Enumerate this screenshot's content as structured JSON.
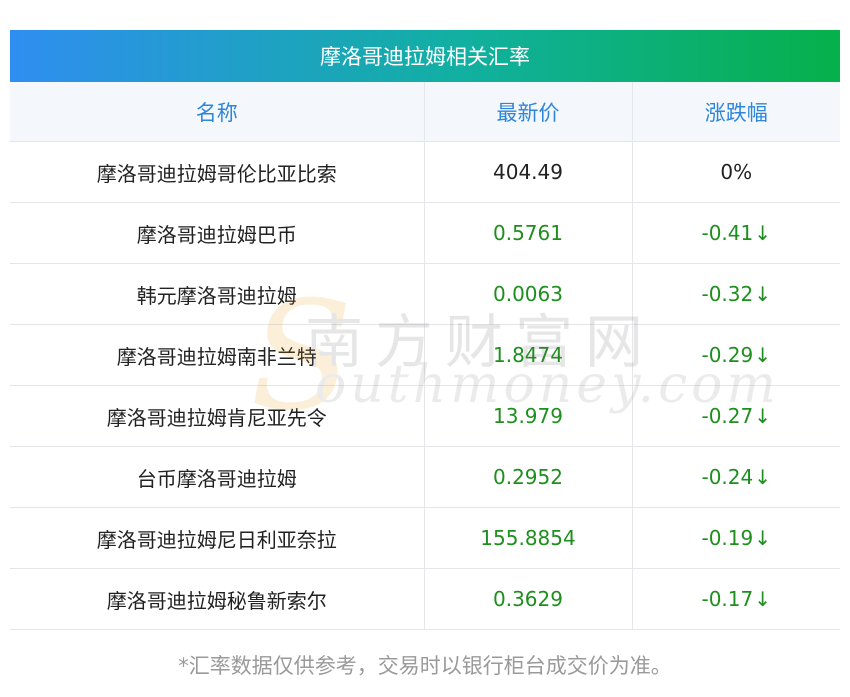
{
  "title": "摩洛哥迪拉姆相关汇率",
  "columns": [
    "名称",
    "最新价",
    "涨跌幅"
  ],
  "colors": {
    "down": "#1e8f1e",
    "neutral": "#222222",
    "header_text": "#2f86d8"
  },
  "rows": [
    {
      "name": "摩洛哥迪拉姆哥伦比亚比索",
      "price": "404.49",
      "change": "0%",
      "arrow": "",
      "trend": "flat"
    },
    {
      "name": "摩洛哥迪拉姆巴币",
      "price": "0.5761",
      "change": "-0.41",
      "arrow": "↓",
      "trend": "down"
    },
    {
      "name": "韩元摩洛哥迪拉姆",
      "price": "0.0063",
      "change": "-0.32",
      "arrow": "↓",
      "trend": "down"
    },
    {
      "name": "摩洛哥迪拉姆南非兰特",
      "price": "1.8474",
      "change": "-0.29",
      "arrow": "↓",
      "trend": "down"
    },
    {
      "name": "摩洛哥迪拉姆肯尼亚先令",
      "price": "13.979",
      "change": "-0.27",
      "arrow": "↓",
      "trend": "down"
    },
    {
      "name": "台币摩洛哥迪拉姆",
      "price": "0.2952",
      "change": "-0.24",
      "arrow": "↓",
      "trend": "down"
    },
    {
      "name": "摩洛哥迪拉姆尼日利亚奈拉",
      "price": "155.8854",
      "change": "-0.19",
      "arrow": "↓",
      "trend": "down"
    },
    {
      "name": "摩洛哥迪拉姆秘鲁新索尔",
      "price": "0.3629",
      "change": "-0.17",
      "arrow": "↓",
      "trend": "down"
    }
  ],
  "footnote": "*汇率数据仅供参考，交易时以银行柜台成交价为准。",
  "watermark": {
    "cn": "南方财富网",
    "en": "outhmoney.com",
    "s": "S"
  }
}
